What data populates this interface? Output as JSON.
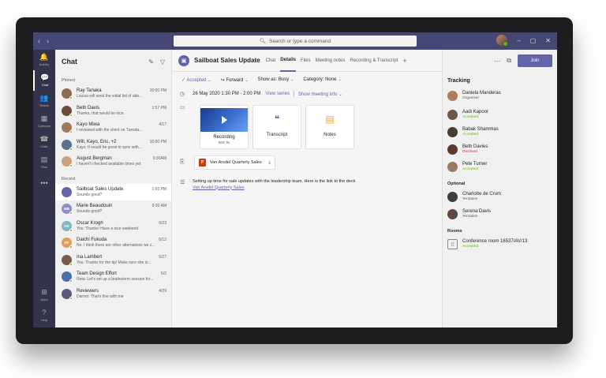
{
  "titlebar": {
    "back": "‹",
    "forward": "›",
    "search_placeholder": "Search or type a command",
    "window_controls": [
      "–",
      "▢",
      "✕"
    ]
  },
  "rail": {
    "items": [
      {
        "label": "Activity",
        "icon": "bell-icon",
        "glyph": "🔔"
      },
      {
        "label": "Chat",
        "icon": "chat-icon",
        "glyph": "💬"
      },
      {
        "label": "Teams",
        "icon": "teams-icon",
        "glyph": "👥"
      },
      {
        "label": "Calendar",
        "icon": "calendar-icon",
        "glyph": "▦"
      },
      {
        "label": "Calls",
        "icon": "phone-icon",
        "glyph": "☎"
      },
      {
        "label": "Files",
        "icon": "files-icon",
        "glyph": "▤"
      },
      {
        "label": "",
        "icon": "more-icon",
        "glyph": "•••"
      }
    ],
    "bottom": [
      {
        "label": "Apps",
        "icon": "apps-icon",
        "glyph": "⊞"
      },
      {
        "label": "Help",
        "icon": "help-icon",
        "glyph": "?"
      }
    ]
  },
  "chatlist": {
    "title": "Chat",
    "pinned_label": "Pinned",
    "recent_label": "Recent",
    "pinned": [
      {
        "name": "Ray Tanaka",
        "time": "10:00 PM",
        "preview": "Louisa will send the initial list of atte...",
        "color": "#8a6a55"
      },
      {
        "name": "Beth Davis",
        "time": "1:57 PM",
        "preview": "Thanks, that would be nice.",
        "color": "#6b4a3a"
      },
      {
        "name": "Kayo Miwa",
        "time": "4/17",
        "preview": "I reviewed with the client on Tuesda...",
        "color": "#a0785c"
      },
      {
        "name": "Will, Kayo, Eric, +2",
        "time": "10:00 PM",
        "preview": "Kayo: It would be great to sync with...",
        "color": "#5b6f8f"
      },
      {
        "name": "August Bergman",
        "time": "9:30AM",
        "preview": "I haven't checked available times yet",
        "color": "#c9a27e"
      }
    ],
    "recent": [
      {
        "name": "Sailboat Sales Update",
        "time": "1:55 PM",
        "preview": "Sounds good?",
        "color": "#6264a7",
        "initials": ""
      },
      {
        "name": "Marie Beaudouin",
        "time": "9:30 AM",
        "preview": "Sounds good?",
        "color": "#8f8ec7",
        "initials": "MB"
      },
      {
        "name": "Oscar Krogh",
        "time": "6/23",
        "preview": "You: Thanks! Have a nice weekend",
        "color": "#7fb7be",
        "initials": "OK"
      },
      {
        "name": "Daichi Fukuda",
        "time": "6/12",
        "preview": "No, I think there are other alternatives we c...",
        "color": "#e59c5b",
        "initials": "DF"
      },
      {
        "name": "Ina Lambert",
        "time": "5/27",
        "preview": "You: Thanks for the tip! Make sure she is...",
        "color": "#7a5a48",
        "initials": ""
      },
      {
        "name": "Team Design Effort",
        "time": "5/2",
        "preview": "Reta: Let's set up a brainstorm session for...",
        "color": "#4a6fa5",
        "initials": ""
      },
      {
        "name": "Reviewers",
        "time": "4/29",
        "preview": "Darren: That's fine with me",
        "color": "#5c5a7a",
        "initials": ""
      }
    ]
  },
  "meeting": {
    "title": "Sailboat Sales Update",
    "tabs": [
      "Chat",
      "Details",
      "Files",
      "Meeting notes",
      "Recording & Transcript"
    ],
    "active_tab": "Details",
    "toolbar": {
      "accepted": "Accepted",
      "forward": "Forward",
      "show_as": "Show as: Busy",
      "category": "Category: None"
    },
    "datetime": "26 May 2020 1:30 PM - 2:00 PM",
    "view_series": "View series",
    "show_info": "Show meeting info",
    "tiles": [
      {
        "label": "Recording",
        "sub": "58m 9s"
      },
      {
        "label": "Transcript",
        "sub": ""
      },
      {
        "label": "Notes",
        "sub": ""
      }
    ],
    "attachment": "Van Arsdel Quarterly Sales",
    "description": "Setting up time for sale updates with the leadership team. Here is the link to the deck",
    "description_link": "Van Arsdel Quarterly Sales"
  },
  "tracking": {
    "join_label": "Join",
    "title": "Tracking",
    "organizer": {
      "name": "Daniela Manderas",
      "status": "Organiser",
      "color": "#b07a5c"
    },
    "required": [
      {
        "name": "Aadi Kapoor",
        "status": "Accepted",
        "kind": "accepted",
        "color": "#6e5646"
      },
      {
        "name": "Babak Shammas",
        "status": "Accepted",
        "kind": "accepted",
        "color": "#4b3a30"
      },
      {
        "name": "Beth Davies",
        "status": "Declined",
        "kind": "declined",
        "color": "#5c3a2e"
      },
      {
        "name": "Pete Turner",
        "status": "Accepted",
        "kind": "accepted",
        "color": "#9a7a66"
      }
    ],
    "optional_label": "Optional",
    "optional": [
      {
        "name": "Charlotte de Crum",
        "status": "Tentative",
        "kind": "neutral",
        "color": "#3d3d3d"
      },
      {
        "name": "Serena Davis",
        "status": "Tentative",
        "kind": "neutral",
        "color": "#5a4a42"
      }
    ],
    "rooms_label": "Rooms",
    "room": {
      "name": "Conference room 16537/AV/13",
      "status": "Accepted"
    }
  },
  "colors": {
    "brand": "#6264a7",
    "titlebar": "#464775",
    "rail": "#33344a",
    "accepted": "#6bb700",
    "declined": "#c4314b"
  }
}
